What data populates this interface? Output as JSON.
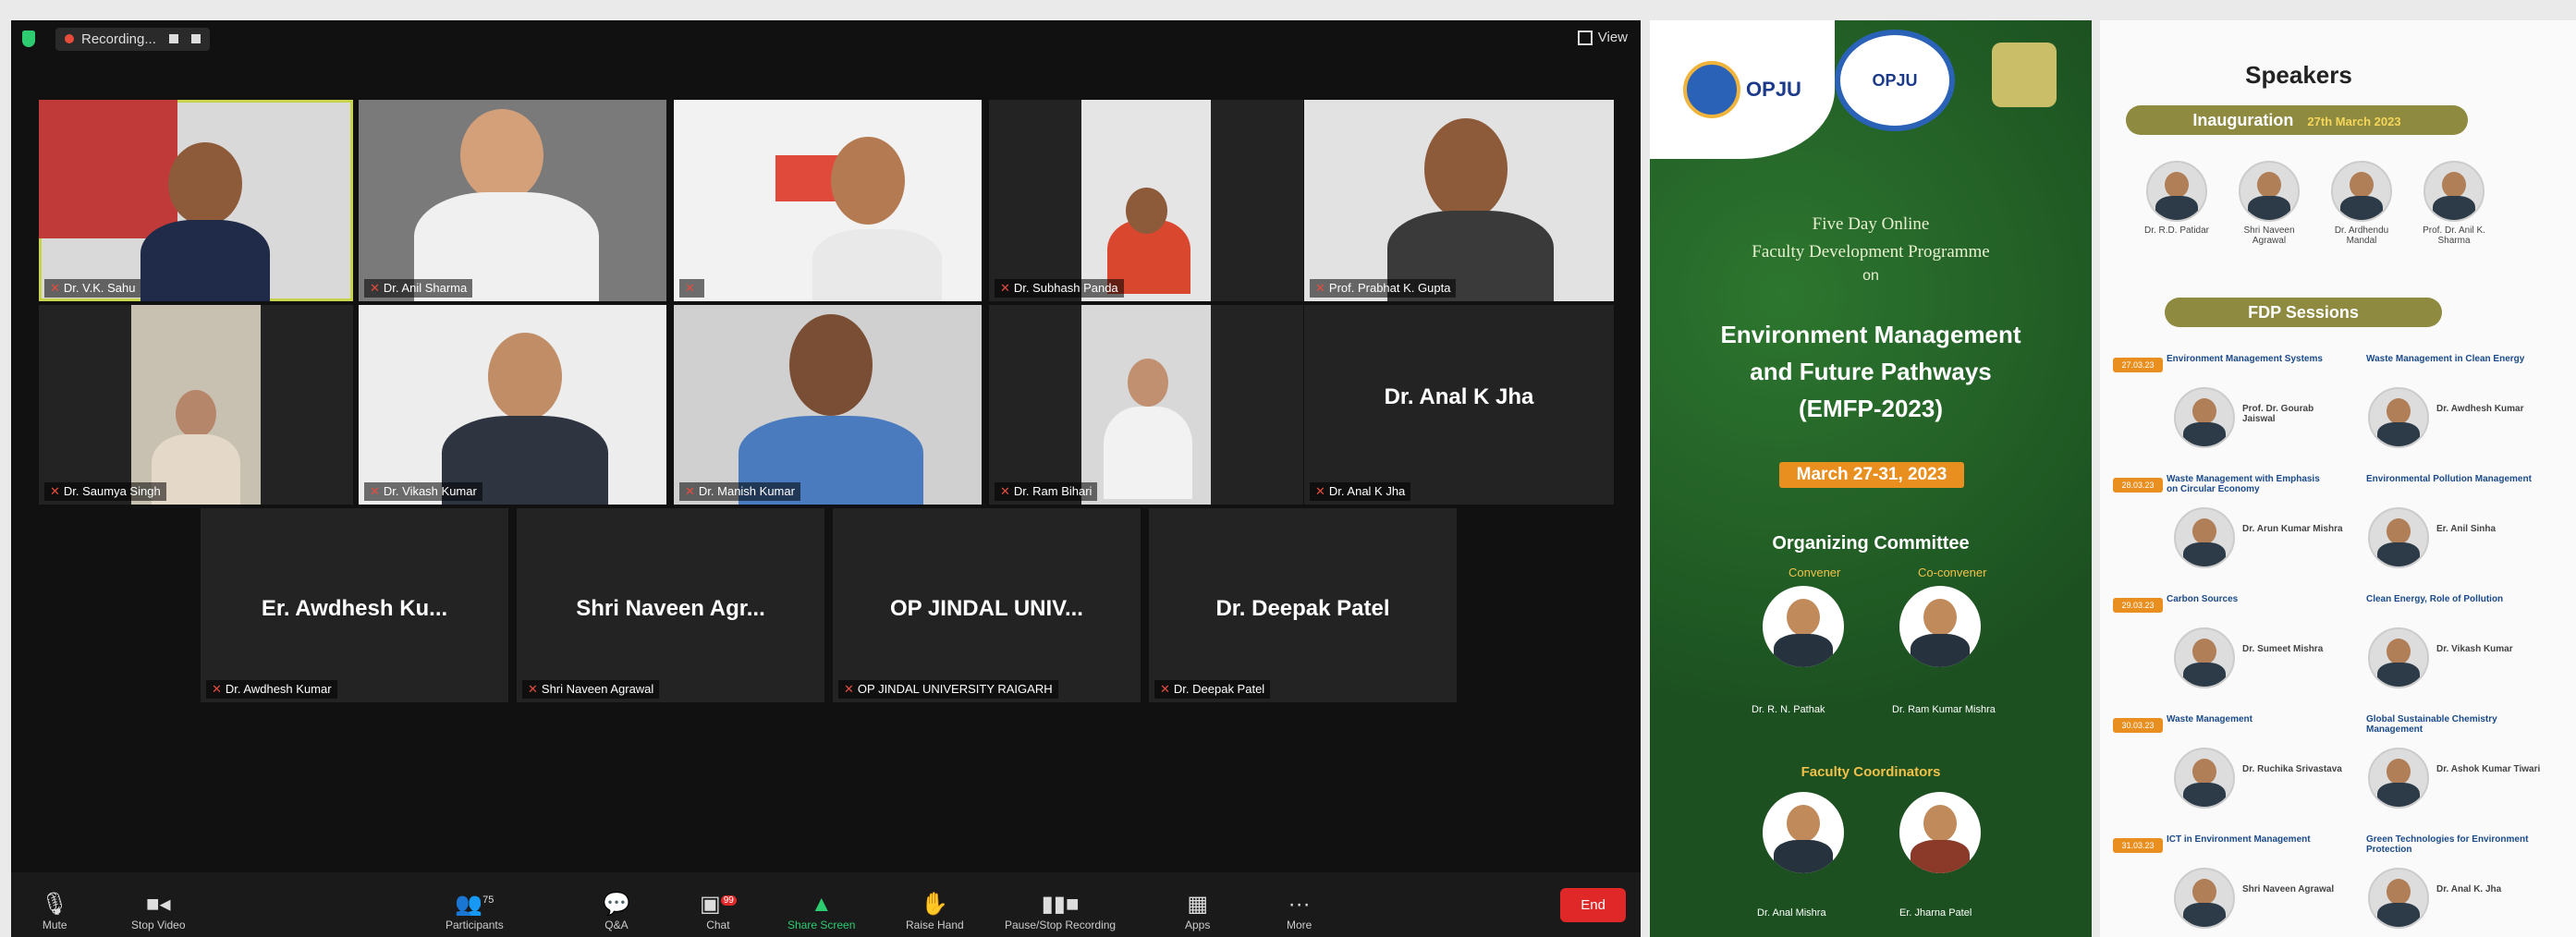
{
  "zoom": {
    "recording_label": "Recording...",
    "view_label": "View",
    "tiles": [
      {
        "name": "Dr. V.K. Sahu"
      },
      {
        "name": "Dr. Anil Sharma"
      },
      {
        "name": ""
      },
      {
        "name": "Dr. Subhash Panda"
      },
      {
        "name": "Prof. Prabhat K. Gupta"
      },
      {
        "name": "Dr. Saumya Singh"
      },
      {
        "name": "Dr. Vikash Kumar"
      },
      {
        "name": "Dr. Manish Kumar"
      },
      {
        "name": "Dr. Ram Bihari"
      },
      {
        "name": "Dr. Anal K Jha",
        "display": "Dr. Anal K Jha"
      },
      {
        "name": "Dr. Awdhesh Kumar",
        "display": "Er. Awdhesh Ku..."
      },
      {
        "name": "Shri Naveen Agrawal",
        "display": "Shri Naveen Agr..."
      },
      {
        "name": "OP JINDAL UNIVERSITY RAIGARH",
        "display": "OP JINDAL UNIV..."
      },
      {
        "name": "Dr. Deepak Patel",
        "display": "Dr. Deepak Patel"
      }
    ],
    "toolbar": {
      "mute": "Mute",
      "stop_video": "Stop Video",
      "participants": "Participants",
      "participants_count": "75",
      "qa": "Q&A",
      "chat": "Chat",
      "chat_badge": "99",
      "share_screen": "Share Screen",
      "raise_hand": "Raise Hand",
      "pause_recording": "Pause/Stop Recording",
      "apps": "Apps",
      "more": "More",
      "end": "End"
    }
  },
  "poster": {
    "logo_left": "OPJU",
    "logo_right": "OPJU",
    "line1": "Five Day Online",
    "line2": "Faculty Development Programme",
    "line3": "on",
    "title1": "Environment Management",
    "title2": "and Future Pathways",
    "title3": "(EMFP-2023)",
    "dates": "March 27-31, 2023",
    "org_heading": "Organizing Committee",
    "org_sub_left": "Convener",
    "org_sub_right": "Co-convener",
    "org_names": [
      "Dr. R. N. Pathak",
      "Dr. Ram Kumar Mishra"
    ],
    "faculty_heading": "Faculty Coordinators",
    "faculty_names": [
      "Dr. Anal Mishra",
      "Er. Jharna Patel"
    ]
  },
  "speakers": {
    "title": "Speakers",
    "inauguration_label": "Inauguration",
    "inauguration_date": "27th March 2023",
    "inaug_names": [
      "Dr. R.D. Patidar",
      "Shri Naveen Agrawal",
      "Dr. Ardhendu Mandal",
      "Prof. Dr. Anil K. Sharma"
    ],
    "sessions_label": "FDP Sessions",
    "sessions": [
      {
        "date": "27.03.23",
        "left_topic": "Environment Management Systems",
        "right_topic": "Waste Management in Clean Energy",
        "left_name": "Prof. Dr. Gourab Jaiswal",
        "right_name": "Dr. Awdhesh Kumar"
      },
      {
        "date": "28.03.23",
        "left_topic": "Waste Management with Emphasis on Circular Economy",
        "right_topic": "Environmental Pollution Management",
        "left_name": "Dr. Arun Kumar Mishra",
        "right_name": "Er. Anil Sinha"
      },
      {
        "date": "29.03.23",
        "left_topic": "Carbon Sources",
        "right_topic": "Clean Energy, Role of Pollution",
        "left_name": "Dr. Sumeet Mishra",
        "right_name": "Dr. Vikash Kumar"
      },
      {
        "date": "30.03.23",
        "left_topic": "Waste Management",
        "right_topic": "Global Sustainable Chemistry Management",
        "left_name": "Dr. Ruchika Srivastava",
        "right_name": "Dr. Ashok Kumar Tiwari"
      },
      {
        "date": "31.03.23",
        "left_topic": "ICT in Environment Management",
        "right_topic": "Green Technologies for Environment Protection",
        "left_name": "Shri Naveen Agrawal",
        "right_name": "Dr. Anal K. Jha"
      }
    ]
  }
}
